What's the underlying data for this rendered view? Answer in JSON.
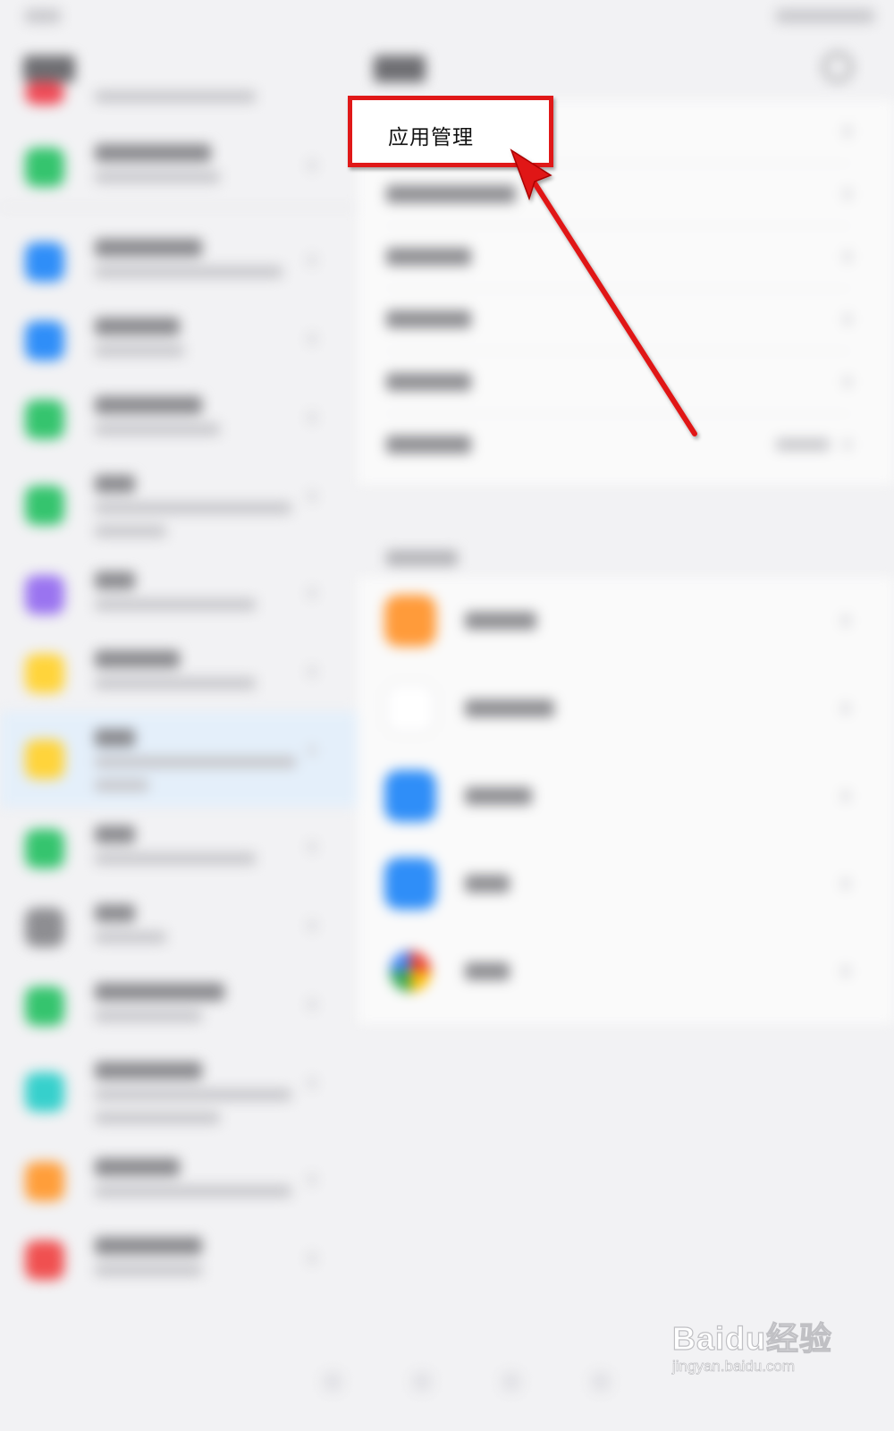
{
  "highlight": {
    "label": "应用管理",
    "color": "#e01818"
  },
  "watermark": {
    "brand": "Baidu经验",
    "url": "jingyan.baidu.com"
  },
  "left_icon_colors": [
    "#ef4b57",
    "#35c46e",
    "#2f8ef8",
    "#2f8ef8",
    "#35c46e",
    "#35c46e",
    "#9a74f0",
    "#ffd43b",
    "#ffd43b",
    "#35c46e",
    "#8e8e92",
    "#35c46e",
    "#36d0cc",
    "#ff9e3a",
    "#f05050"
  ],
  "app_icon_colors": [
    "#ff9b3a",
    "#ffffff",
    "#2f8ef8",
    "#2f8ef8",
    "#e94b8a"
  ]
}
